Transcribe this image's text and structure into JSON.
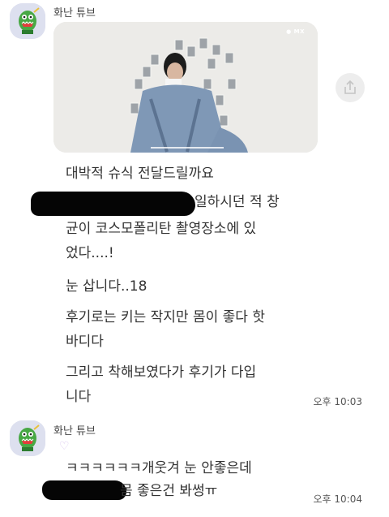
{
  "messages_top": {
    "sender": "화난 튜브",
    "video_badge": "● MX",
    "lines": [
      "대박적 슈식 전달드릴까요",
      "일하시던 적 창",
      "균이 코스모폴리탄 촬영장소에 있",
      "었다....!",
      "눈 삽니다..18",
      "후기로는 키는 작지만 몸이 좋다 핫",
      "바디다",
      "그리고 착해보였다가 후기가 다입",
      "니다"
    ],
    "time": "오후 10:03"
  },
  "messages_bottom": {
    "sender": "화난 튜브",
    "reaction": "♡",
    "lines": [
      "ㅋㅋㅋㅋㅋㅋ개웃겨 눈 안좋은데",
      "몸 좋은건 봐썽ㅠ"
    ],
    "time": "오후 10:04"
  },
  "icons": {
    "avatar": "green-crocodile-avatar",
    "share": "share-icon"
  },
  "colors": {
    "background": "#ffffff",
    "avatar_bg": "#dde0ef",
    "share_bg": "#ededed",
    "reaction": "#d9c6ef"
  }
}
